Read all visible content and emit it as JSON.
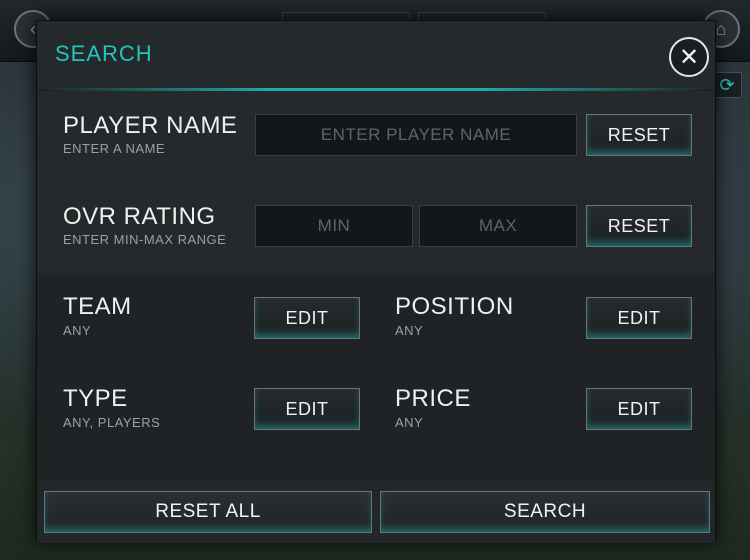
{
  "modal": {
    "title": "SEARCH",
    "close_glyph": "✕"
  },
  "player_name": {
    "label": "PLAYER NAME",
    "sub": "ENTER A NAME",
    "placeholder": "ENTER PLAYER NAME",
    "value": "",
    "reset_label": "RESET"
  },
  "ovr_rating": {
    "label": "OVR RATING",
    "sub": "ENTER MIN-MAX RANGE",
    "min_placeholder": "MIN",
    "max_placeholder": "MAX",
    "reset_label": "RESET"
  },
  "team": {
    "label": "TEAM",
    "sub": "ANY",
    "edit_label": "EDIT"
  },
  "position": {
    "label": "POSITION",
    "sub": "ANY",
    "edit_label": "EDIT"
  },
  "type": {
    "label": "TYPE",
    "sub": "ANY, PLAYERS",
    "edit_label": "EDIT"
  },
  "price": {
    "label": "PRICE",
    "sub": "ANY",
    "edit_label": "EDIT"
  },
  "footer": {
    "reset_all_label": "RESET ALL",
    "search_label": "SEARCH"
  },
  "colors": {
    "accent": "#22c6c0",
    "panel": "#1c2023"
  },
  "icons": {
    "close": "close-icon",
    "back": "back-arrow-icon",
    "home": "home-icon",
    "refresh": "refresh-icon"
  }
}
